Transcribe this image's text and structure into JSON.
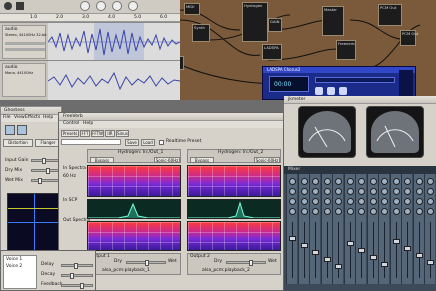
{
  "patchbay": {
    "nodes": [
      "MIDI",
      "Synth",
      "Hydrogen",
      "GAIN",
      "LADSPA",
      "Master",
      "Freeverb",
      "PCM Out",
      "PCM Out",
      "Ardour",
      "Midi In",
      "LADSPA Chorus2"
    ],
    "accent": "#7a5a3a"
  },
  "audacity": {
    "ruler": [
      "1.0",
      "2.0",
      "3.0",
      "4.0",
      "5.0",
      "6.0"
    ],
    "tracks": [
      {
        "name": "audio",
        "info": "Stereo, 44100Hz 32-bit float",
        "scale": [
          "1.0",
          "0.5",
          "0.0",
          "-0.5",
          "-1.0"
        ]
      },
      {
        "name": "audio",
        "info": "Mono, 44100Hz",
        "scale": [
          "1.0",
          "0.0",
          "-1.0"
        ]
      }
    ]
  },
  "player": {
    "title": "LADSPA Chorus2",
    "time": "00:00"
  },
  "meters": {
    "tabs": [
      "Volume",
      "Phase"
    ],
    "title": "jkmeter"
  },
  "mixer": {
    "title": "Mixer",
    "strip_count": 13
  },
  "effect": {
    "title": "Ghostess",
    "menu": [
      "File",
      "View",
      "Effects",
      "Help"
    ],
    "tabs": [
      "Distortion",
      "Flanger"
    ],
    "params": [
      "Input Gain",
      "Dry Mix",
      "Wet Mix"
    ],
    "list": [
      "Channel 1",
      "Channel 2"
    ]
  },
  "analyzer": {
    "title": "FreeVerb",
    "menu": [
      "Control",
      "Help"
    ],
    "tabs": [
      "Presets",
      "FFT",
      "FFTW",
      "IIR",
      "Sinus"
    ],
    "buttons": [
      "Save",
      "Load",
      "Realtime Preset"
    ],
    "side_labels": [
      "In Spectra",
      "60 Hz",
      "In SCP",
      "Out Spectra",
      "Mix IN",
      "Link IN"
    ],
    "channels": [
      {
        "name": "Hydrogen: In:/Out_1",
        "mode": "Bypass",
        "rate": "Sonic-60Hz"
      },
      {
        "name": "Hydrogen: In:/Out_2",
        "mode": "Bypass",
        "rate": "Sonic-60Hz"
      }
    ],
    "outputs": [
      {
        "label": "Output 1",
        "target": "alsa_pcm:playback_1",
        "mix": "Dry",
        "out": "Wet"
      },
      {
        "label": "Output 2",
        "target": "alsa_pcm:playback_2",
        "mix": "Dry",
        "out": "Wet"
      }
    ]
  },
  "plugin": {
    "items": [
      "Voice 1",
      "Voice 2"
    ],
    "params": [
      "Delay",
      "Decay",
      "Feedback"
    ]
  }
}
